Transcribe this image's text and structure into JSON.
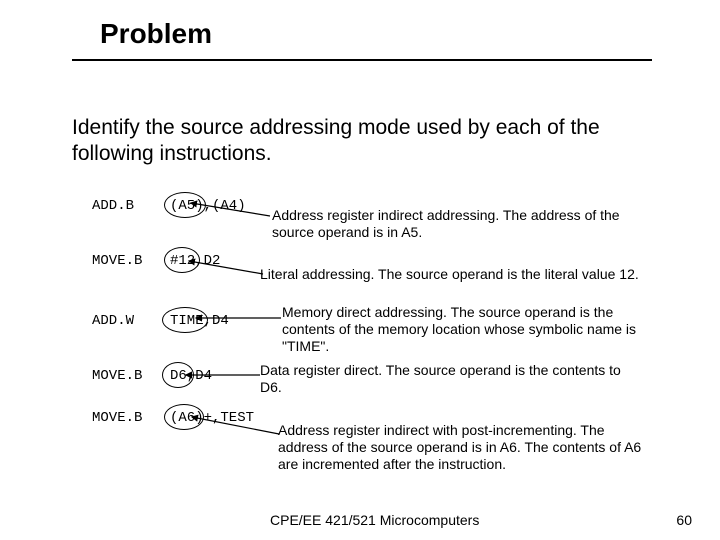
{
  "title": "Problem",
  "intro": "Identify the source addressing mode used by each of the following instructions.",
  "rows": [
    {
      "opcode": "ADD.B",
      "operands": "(A5),(A4)"
    },
    {
      "opcode": "MOVE.B",
      "operands": "#12,D2"
    },
    {
      "opcode": "ADD.W",
      "operands": "TIME,D4"
    },
    {
      "opcode": "MOVE.B",
      "operands": "D6,D4"
    },
    {
      "opcode": "MOVE.B",
      "operands": "(A6)+,TEST"
    }
  ],
  "explanations": [
    "Address register indirect addressing. The address of the source operand is in A5.",
    "Literal addressing. The source operand is the literal value 12.",
    "Memory direct addressing. The source operand is the contents of the memory location whose symbolic name is \"TIME\".",
    "Data register direct. The source operand is the contents to D6.",
    "Address register indirect with post-incrementing. The address of the source operand is in A6. The contents of A6 are incremented after the instruction."
  ],
  "footer": {
    "course": "CPE/EE 421/521 Microcomputers",
    "page": "60"
  }
}
